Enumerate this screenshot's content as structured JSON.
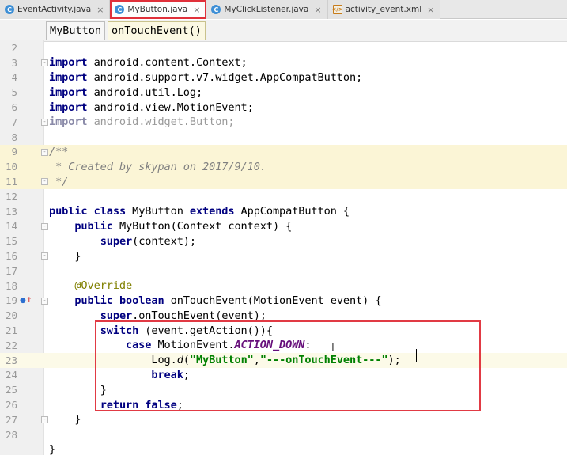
{
  "tabs": [
    {
      "label": "EventActivity.java",
      "icon": "c-class-icon",
      "active": false
    },
    {
      "label": "MyButton.java",
      "icon": "c-class-icon",
      "active": true
    },
    {
      "label": "MyClickListener.java",
      "icon": "c-class-icon",
      "active": false
    },
    {
      "label": "activity_event.xml",
      "icon": "xml-file-icon",
      "active": false
    }
  ],
  "breadcrumb": {
    "class_name": "MyButton",
    "method_name": "onTouchEvent()"
  },
  "lines": {
    "l2": "2",
    "l3": "3",
    "l4": "4",
    "l5": "5",
    "l6": "6",
    "l7": "7",
    "l8": "8",
    "l9": "9",
    "l10": "10",
    "l11": "11",
    "l12": "12",
    "l13": "13",
    "l14": "14",
    "l15": "15",
    "l16": "16",
    "l17": "17",
    "l18": "18",
    "l19": "19",
    "l20": "20",
    "l21": "21",
    "l22": "22",
    "l23": "23",
    "l24": "24",
    "l25": "25",
    "l26": "26",
    "l27": "27",
    "l28": "28"
  },
  "code": {
    "import_kw": "import",
    "imp3": " android.content.Context;",
    "imp4": " android.support.v7.widget.AppCompatButton;",
    "imp5": " android.util.Log;",
    "imp6": " android.view.MotionEvent;",
    "imp7": " android.widget.Button;",
    "doc9": "/**",
    "doc10": " * Created by skypan on 2017/9/10.",
    "doc11": " */",
    "public_kw": "public",
    "class_kw": "class",
    "extends_kw": "extends",
    "l13_name": " MyButton ",
    "l13_rest": " AppCompatButton {",
    "l14_indent": "    ",
    "l14_rest": " MyButton(Context context) {",
    "l15_indent": "        ",
    "super_kw": "super",
    "l15_rest": "(context);",
    "l16": "    }",
    "l18_indent": "    ",
    "override": "@Override",
    "l19_indent": "    ",
    "boolean_kw": "boolean",
    "l19_rest": " onTouchEvent(MotionEvent event) {",
    "l20_indent": "        ",
    "l20_rest": ".onTouchEvent(event);",
    "l21_indent": "        ",
    "switch_kw": "switch",
    "l21_rest": " (event.getAction()){",
    "l22_indent": "            ",
    "case_kw": "case",
    "l22_mid": " MotionEvent.",
    "action_down": "ACTION_DOWN",
    "l22_end": ":",
    "l23_indent": "                ",
    "l23_log": "Log.",
    "l23_d": "d",
    "l23_open": "(",
    "str_tag": "\"MyButton\"",
    "l23_comma": ",",
    "str_msg": "\"---onTouchEvent---\"",
    "l23_end": ");",
    "l24_indent": "                ",
    "break_kw": "break",
    "l24_end": ";",
    "l25": "        }",
    "l26_indent": "        ",
    "return_kw": "return",
    "false_kw": "false",
    "l26_end": ";",
    "l27": "    }",
    "l29": "}"
  },
  "icons": {
    "override_marker": "override-gutter-icon"
  },
  "colors": {
    "highlight_border": "#e13a44",
    "keyword": "#000080",
    "string": "#008000",
    "doc_bg": "#fbf5d6"
  }
}
